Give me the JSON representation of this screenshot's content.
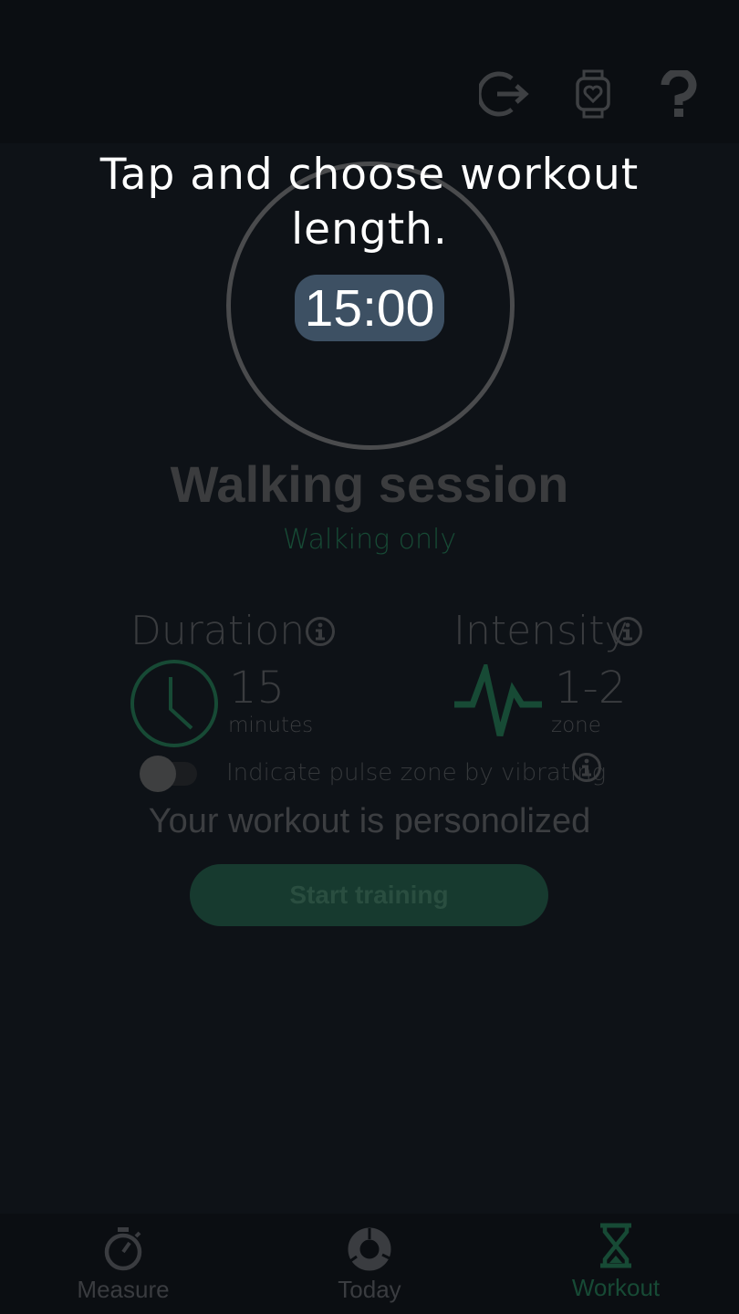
{
  "header": {
    "icons": [
      "logout-icon",
      "smartwatch-heart-icon",
      "help-icon"
    ]
  },
  "tooltip": {
    "text": "Tap and choose workout length."
  },
  "timer": {
    "value": "15:00"
  },
  "session": {
    "title": "Walking session",
    "subtitle": "Walking only"
  },
  "duration": {
    "label": "Duration",
    "value": "15",
    "unit": "minutes"
  },
  "intensity": {
    "label": "Intensity",
    "value": "1-2",
    "unit": "zone"
  },
  "vibrate": {
    "label": "Indicate pulse zone by vibrating",
    "enabled": false
  },
  "personalized_text": "Your workout is personolized",
  "start_button": "Start training",
  "nav": {
    "items": [
      {
        "label": "Measure",
        "icon": "stopwatch-icon",
        "active": false
      },
      {
        "label": "Today",
        "icon": "donut-icon",
        "active": false
      },
      {
        "label": "Workout",
        "icon": "hourglass-icon",
        "active": true
      }
    ]
  },
  "colors": {
    "accent": "#174a35",
    "pill": "#3d5063",
    "background": "#0e1217"
  }
}
